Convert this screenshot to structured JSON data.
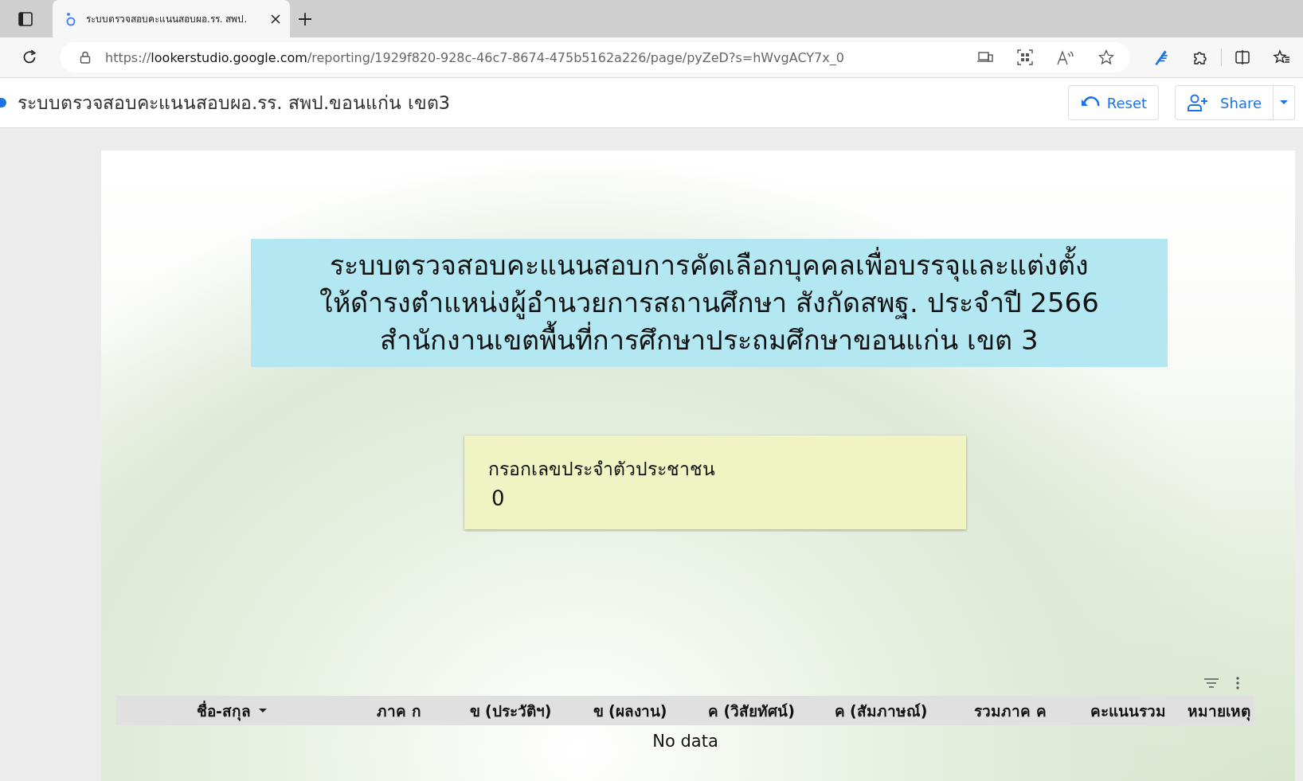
{
  "browser": {
    "tab_title": "ระบบตรวจสอบคะแนนสอบผอ.รร. สพป.",
    "url_prefix": "https://",
    "url_host": "lookerstudio.google.com",
    "url_path": "/reporting/1929f820-928c-46c7-8674-475b5162a226/page/pyZeD?s=hWvgACY7x_0"
  },
  "header": {
    "title": "ระบบตรวจสอบคะแนนสอบผอ.รร. สพป.ขอนแก่น เขต3",
    "reset": "Reset",
    "share": "Share"
  },
  "banner": {
    "lines": [
      "ระบบตรวจสอบคะแนนสอบการคัดเลือกบุคคลเพื่อบรรจุและแต่งตั้ง",
      "ให้ดำรงตำแหน่งผู้อำนวยการสถานศึกษา  สังกัดสพฐ. ประจำปี 2566",
      "สำนักงานเขตพื้นที่การศึกษาประถมศึกษาขอนแก่น เขต 3"
    ]
  },
  "input": {
    "label": "กรอกเลขประจำตัวประชาชน",
    "value": "0"
  },
  "table": {
    "columns": [
      {
        "label": "ชื่อ-สกุล",
        "sorted": true
      },
      {
        "label": "ภาค ก",
        "sorted": false
      },
      {
        "label": "ข (ประวัติฯ)",
        "sorted": false
      },
      {
        "label": "ข (ผลงาน)",
        "sorted": false
      },
      {
        "label": "ค (วิสัยทัศน์)",
        "sorted": false
      },
      {
        "label": "ค (สัมภาษณ์)",
        "sorted": false
      },
      {
        "label": "รวมภาค ค",
        "sorted": false
      },
      {
        "label": "คะแนนรวม",
        "sorted": false
      },
      {
        "label": "หมายเหตุ",
        "sorted": false
      }
    ],
    "empty_text": "No data"
  }
}
